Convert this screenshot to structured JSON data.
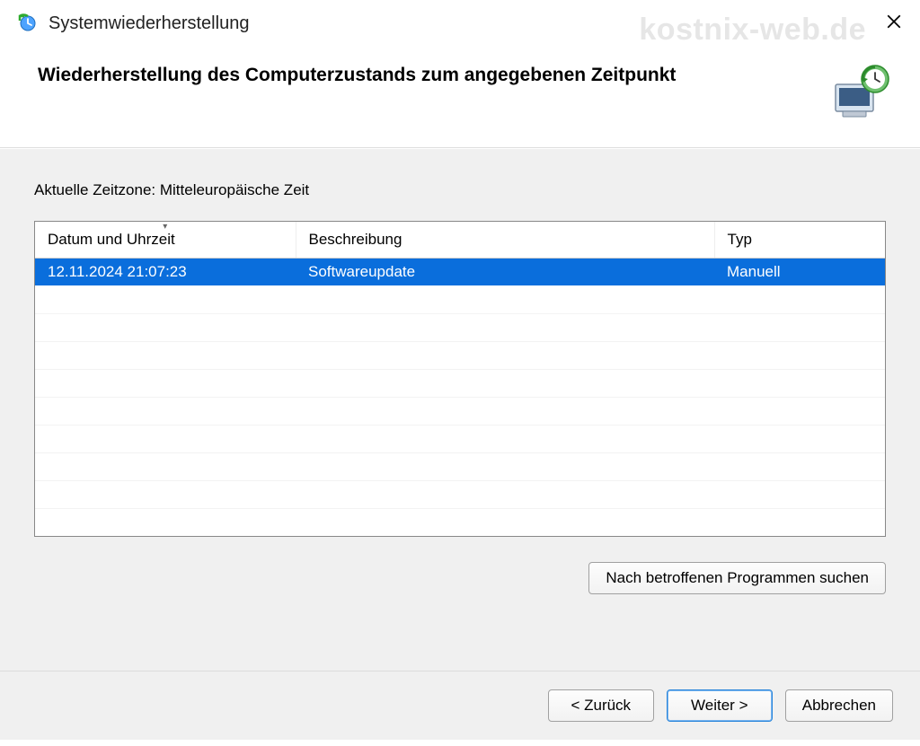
{
  "watermark": "kostnix-web.de",
  "titlebar": {
    "title": "Systemwiederherstellung"
  },
  "header": {
    "title": "Wiederherstellung des Computerzustands zum angegebenen Zeitpunkt"
  },
  "content": {
    "timezone_label": "Aktuelle Zeitzone: Mitteleuropäische Zeit",
    "columns": {
      "date": "Datum und Uhrzeit",
      "description": "Beschreibung",
      "type": "Typ"
    },
    "rows": [
      {
        "date": "12.11.2024 21:07:23",
        "description": "Softwareupdate",
        "type": "Manuell"
      }
    ],
    "scan_button": "Nach betroffenen Programmen suchen"
  },
  "footer": {
    "back": "< Zurück",
    "next": "Weiter >",
    "cancel": "Abbrechen"
  }
}
